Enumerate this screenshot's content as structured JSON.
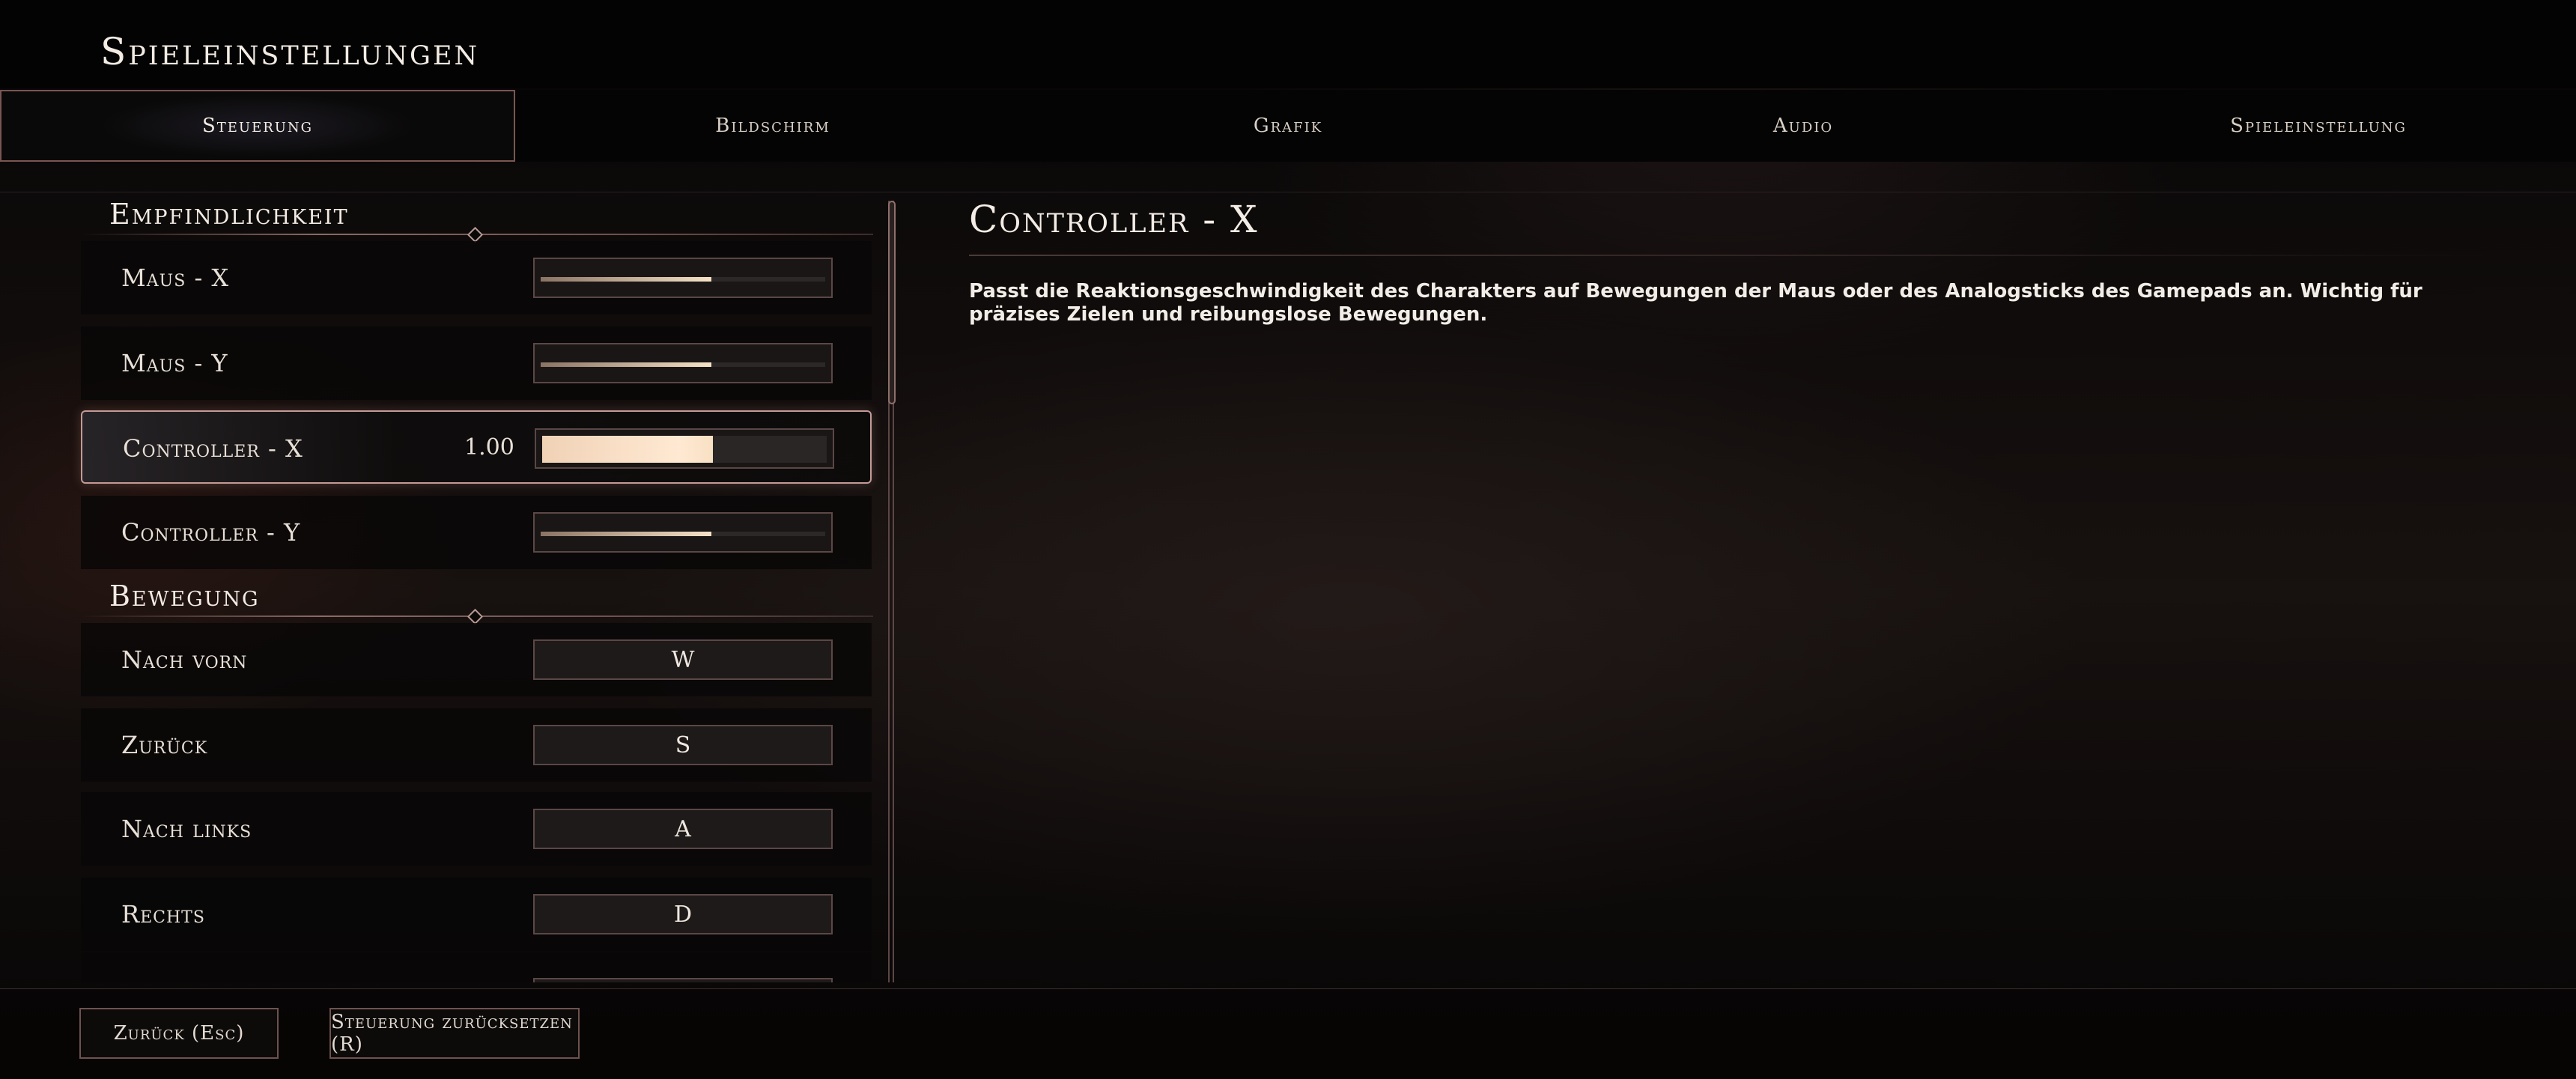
{
  "window": {
    "title": "Spieleinstellungen"
  },
  "tabs": [
    {
      "label": "Steuerung",
      "active": true
    },
    {
      "label": "Bildschirm",
      "active": false
    },
    {
      "label": "Grafik",
      "active": false
    },
    {
      "label": "Audio",
      "active": false
    },
    {
      "label": "Spieleinstellung",
      "active": false
    }
  ],
  "sections": {
    "sensitivity": {
      "title": "Empfindlichkeit",
      "items": [
        {
          "label": "Maus - X",
          "value_fraction": 0.6
        },
        {
          "label": "Maus - Y",
          "value_fraction": 0.6
        },
        {
          "label": "Controller - X",
          "value": "1.00",
          "value_fraction": 0.6,
          "selected": true
        },
        {
          "label": "Controller - Y",
          "value_fraction": 0.6
        }
      ]
    },
    "movement": {
      "title": "Bewegung",
      "items": [
        {
          "label": "Nach vorn",
          "key": "W"
        },
        {
          "label": "Zurück",
          "key": "S"
        },
        {
          "label": "Nach links",
          "key": "A"
        },
        {
          "label": "Rechts",
          "key": "D"
        }
      ]
    }
  },
  "detail": {
    "title": "Controller - X",
    "description": "Passt die Reaktionsgeschwindigkeit des Charakters auf Bewegungen der Maus oder des Analogsticks des Gamepads an. Wichtig für präzises Zielen und reibungslose Bewegungen."
  },
  "footer": {
    "back_label": "Zurück (Esc)",
    "reset_label": "Steuerung zurücksetzen (R)"
  },
  "colors": {
    "accent": "#c49a96",
    "slider_fill": "#f6e2c6"
  }
}
